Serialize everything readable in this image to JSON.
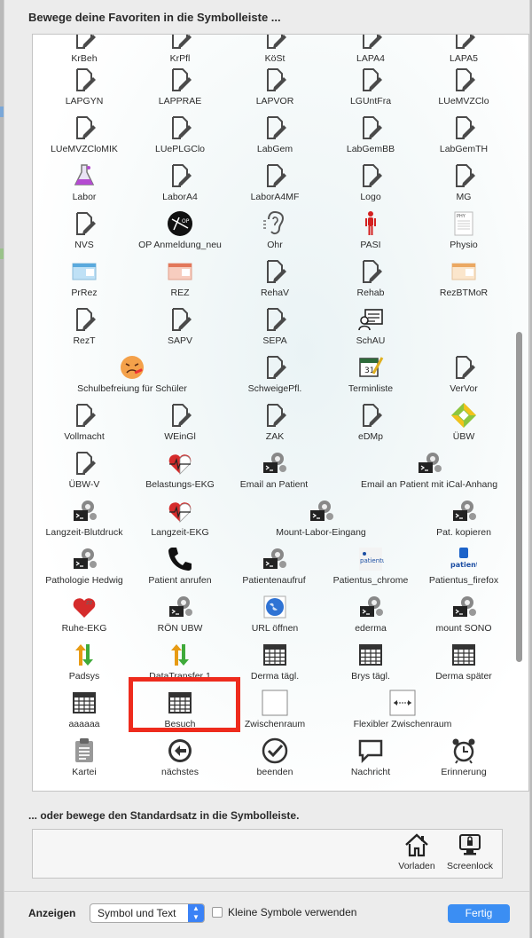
{
  "heading": "Bewege deine Favoriten in die Symbolleiste ...",
  "items": [
    {
      "label": "KrBeh",
      "icon": "doc-edit-icon"
    },
    {
      "label": "KrPfl",
      "icon": "doc-edit-icon"
    },
    {
      "label": "KöSt",
      "icon": "doc-edit-icon"
    },
    {
      "label": "LAPA4",
      "icon": "doc-edit-icon"
    },
    {
      "label": "LAPA5",
      "icon": "doc-edit-icon"
    },
    {
      "label": "LAPGYN",
      "icon": "doc-edit-icon"
    },
    {
      "label": "LAPPRAE",
      "icon": "doc-edit-icon"
    },
    {
      "label": "LAPVOR",
      "icon": "doc-edit-icon"
    },
    {
      "label": "LGUntFra",
      "icon": "doc-edit-icon"
    },
    {
      "label": "LUeMVZClo",
      "icon": "doc-edit-icon"
    },
    {
      "label": "LUeMVZCloMIK",
      "icon": "doc-edit-icon"
    },
    {
      "label": "LUePLGClo",
      "icon": "doc-edit-icon"
    },
    {
      "label": "LabGem",
      "icon": "doc-edit-icon"
    },
    {
      "label": "LabGemBB",
      "icon": "doc-edit-icon"
    },
    {
      "label": "LabGemTH",
      "icon": "doc-edit-icon"
    },
    {
      "label": "Labor",
      "icon": "flask-icon"
    },
    {
      "label": "LaborA4",
      "icon": "doc-edit-icon"
    },
    {
      "label": "LaborA4MF",
      "icon": "doc-edit-icon"
    },
    {
      "label": "Logo",
      "icon": "doc-edit-icon"
    },
    {
      "label": "MG",
      "icon": "doc-edit-icon"
    },
    {
      "label": "NVS",
      "icon": "doc-edit-icon"
    },
    {
      "label": "OP Anmeldung_neu",
      "icon": "op-logo-icon"
    },
    {
      "label": "Ohr",
      "icon": "ear-icon"
    },
    {
      "label": "PASI",
      "icon": "body-figure-icon"
    },
    {
      "label": "Physio",
      "icon": "physio-sheet-icon"
    },
    {
      "label": "PrRez",
      "icon": "prescription-blue-icon"
    },
    {
      "label": "REZ",
      "icon": "prescription-red-icon"
    },
    {
      "label": "RehaV",
      "icon": "doc-edit-icon"
    },
    {
      "label": "Rehab",
      "icon": "doc-edit-icon"
    },
    {
      "label": "RezBTMoR",
      "icon": "prescription-orange-icon"
    },
    {
      "label": "RezT",
      "icon": "doc-edit-icon"
    },
    {
      "label": "SAPV",
      "icon": "doc-edit-icon"
    },
    {
      "label": "SEPA",
      "icon": "doc-edit-icon"
    },
    {
      "label": "SchAU",
      "icon": "sick-note-icon"
    },
    {
      "label": "Schulbefreiung für Schüler",
      "icon": "sick-face-icon"
    },
    {
      "label": "SchweigePfl.",
      "icon": "doc-edit-icon"
    },
    {
      "label": "Terminliste",
      "icon": "calendar-pen-icon"
    },
    {
      "label": "VerVor",
      "icon": "doc-edit-icon"
    },
    {
      "label": "Vollmacht",
      "icon": "doc-edit-icon"
    },
    {
      "label": "WEinGl",
      "icon": "doc-edit-icon"
    },
    {
      "label": "ZAK",
      "icon": "doc-edit-icon"
    },
    {
      "label": "eDMp",
      "icon": "doc-edit-icon"
    },
    {
      "label": "ÜBW",
      "icon": "arrows-cycle-icon"
    },
    {
      "label": "ÜBW-V",
      "icon": "doc-edit-icon"
    },
    {
      "label": "Belastungs-EKG",
      "icon": "heart-ecg-icon"
    },
    {
      "label": "Email an Patient",
      "icon": "script-gear-icon"
    },
    {
      "label": "Email an Patient mit iCal-Anhang",
      "icon": "script-gear-icon"
    },
    {
      "label": "Langzeit-Blutdruck",
      "icon": "script-gear-icon"
    },
    {
      "label": "Langzeit-EKG",
      "icon": "heart-ecg-icon"
    },
    {
      "label": "Mount-Labor-Eingang",
      "icon": "script-gear-icon"
    },
    {
      "label": "Pat. kopieren",
      "icon": "script-gear-icon"
    },
    {
      "label": "Pathologie Hedwig",
      "icon": "script-gear-icon"
    },
    {
      "label": "Patient anrufen",
      "icon": "phone-icon"
    },
    {
      "label": "Patientenaufruf",
      "icon": "script-gear-icon"
    },
    {
      "label": "Patientus_chrome",
      "icon": "patientus-icon"
    },
    {
      "label": "Patientus_firefox",
      "icon": "patientus-blue-icon"
    },
    {
      "label": "Ruhe-EKG",
      "icon": "heart-sleep-icon"
    },
    {
      "label": "RÖN UBW",
      "icon": "script-gear-icon"
    },
    {
      "label": "URL öffnen",
      "icon": "globe-icon"
    },
    {
      "label": "ederma",
      "icon": "script-gear-icon"
    },
    {
      "label": "mount SONO",
      "icon": "script-gear-icon"
    },
    {
      "label": "Padsys",
      "icon": "sync-arrows-icon"
    },
    {
      "label": "DataTransfer 1",
      "icon": "sync-arrows-icon"
    },
    {
      "label": "Derma tägl.",
      "icon": "table-icon"
    },
    {
      "label": "Brys tägl.",
      "icon": "table-icon"
    },
    {
      "label": "Derma später",
      "icon": "table-icon"
    },
    {
      "label": "aaaaaa",
      "icon": "table-icon"
    },
    {
      "label": "Besuch",
      "icon": "table-icon"
    },
    {
      "label": "Zwischenraum",
      "icon": "space-icon"
    },
    {
      "label": "Flexibler Zwischenraum",
      "icon": "flexible-space-icon"
    },
    {
      "label": "Kartei",
      "icon": "clipboard-icon"
    },
    {
      "label": "nächstes",
      "icon": "arrow-left-circle-icon"
    },
    {
      "label": "beenden",
      "icon": "check-circle-icon"
    },
    {
      "label": "Nachricht",
      "icon": "speech-bubble-icon"
    },
    {
      "label": "Erinnerung",
      "icon": "alarm-clock-icon"
    }
  ],
  "standard_heading": "... oder bewege den Standardsatz in die Symbolleiste.",
  "standard_items": [
    {
      "label": "Vorladen",
      "icon": "house-icon"
    },
    {
      "label": "Screenlock",
      "icon": "screen-lock-icon"
    }
  ],
  "footer": {
    "show_label": "Anzeigen",
    "select_value": "Symbol und Text",
    "checkbox_label": "Kleine Symbole verwenden",
    "done_label": "Fertig"
  },
  "colors": {
    "accent": "#3b8ef3",
    "highlight": "#ee2b1d"
  }
}
